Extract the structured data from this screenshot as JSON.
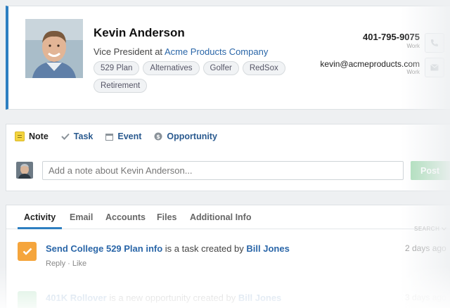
{
  "contact": {
    "name": "Kevin Anderson",
    "title_prefix": "Vice President at ",
    "company": "Acme Products Company",
    "tags": [
      "529 Plan",
      "Alternatives",
      "Golfer",
      "RedSox",
      "Retirement"
    ],
    "phone": "401-795-9075",
    "phone_label": "Work",
    "email": "kevin@acmeproducts.com",
    "email_label": "Work"
  },
  "composer": {
    "tabs": [
      {
        "label": "Note",
        "icon": "note-icon"
      },
      {
        "label": "Task",
        "icon": "check-icon"
      },
      {
        "label": "Event",
        "icon": "calendar-icon"
      },
      {
        "label": "Opportunity",
        "icon": "dollar-icon"
      }
    ],
    "placeholder": "Add a note about Kevin Anderson...",
    "post_label": "Post"
  },
  "activity": {
    "tabs": [
      "Activity",
      "Email",
      "Accounts",
      "Files",
      "Additional Info"
    ],
    "search_label": "SEARCH",
    "items": [
      {
        "link": "Send College 529 Plan info",
        "middle": " is a task created by ",
        "author": "Bill Jones",
        "time": "2 days ago",
        "actions": "Reply · Like"
      },
      {
        "link": "401K Rollover",
        "middle": " is a new opportunity created by ",
        "author": "Bill Jones",
        "time": "3 days ago"
      }
    ]
  },
  "colors": {
    "accent": "#2d7fc1",
    "link": "#2a66a8",
    "task": "#f5a53c",
    "post": "#a8dcb6"
  }
}
